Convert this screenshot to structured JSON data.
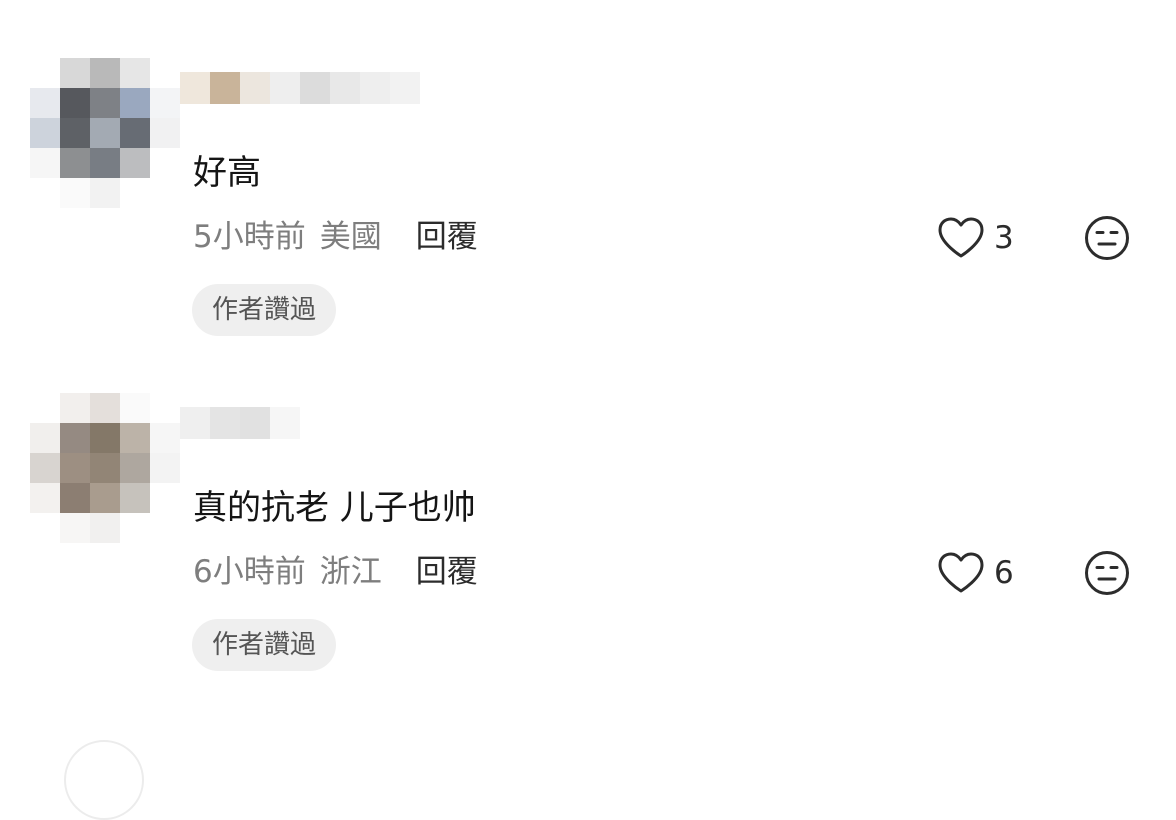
{
  "comments": [
    {
      "text": "好高",
      "time": "5小時前",
      "location": "美國",
      "reply_label": "回覆",
      "likes": "3",
      "badge": "作者讚過",
      "like_icon": "heart-icon",
      "reaction_icon": "meh-face-icon",
      "avatar_pixels": [
        "#ffffff",
        "#d8d8d8",
        "#b9b9b9",
        "#e6e6e6",
        "#ffffff",
        "#e7e9ee",
        "#56585d",
        "#7e8186",
        "#9aa8bf",
        "#f3f4f6",
        "#cdd3dc",
        "#5e6166",
        "#a3aab3",
        "#676c74",
        "#f1f1f2",
        "#f6f6f6",
        "#8d8f91",
        "#787d84",
        "#bcbdbf",
        "#ffffff",
        "#ffffff",
        "#fafafa",
        "#f2f2f2",
        "#ffffff",
        "#ffffff"
      ],
      "username_pixels": [
        "#efe7dc",
        "#c9b49a",
        "#ece6de",
        "#eeeeee",
        "#dcdcdc",
        "#e8e8e8",
        "#eeeeee",
        "#f2f2f2"
      ]
    },
    {
      "text": "真的抗老 儿子也帅",
      "time": "6小時前",
      "location": "浙江",
      "reply_label": "回覆",
      "likes": "6",
      "badge": "作者讚過",
      "like_icon": "heart-icon",
      "reaction_icon": "meh-face-icon",
      "avatar_pixels": [
        "#ffffff",
        "#f2efed",
        "#e4dfdb",
        "#fafafa",
        "#ffffff",
        "#f1efed",
        "#958a82",
        "#847868",
        "#bcb3a8",
        "#f6f6f6",
        "#d8d4d0",
        "#9d8f82",
        "#928576",
        "#aea79f",
        "#f3f3f3",
        "#f3f1ef",
        "#8c7e72",
        "#a99c8e",
        "#c6c2bc",
        "#ffffff",
        "#ffffff",
        "#f7f6f5",
        "#f1f0ef",
        "#ffffff",
        "#ffffff"
      ],
      "username_pixels": [
        "#efefef",
        "#e4e4e4",
        "#e1e1e1",
        "#f6f6f6"
      ]
    }
  ],
  "colors": {
    "text_primary": "#151515",
    "text_secondary": "#7e7e7e",
    "badge_bg": "#efefef",
    "badge_text": "#555555"
  }
}
